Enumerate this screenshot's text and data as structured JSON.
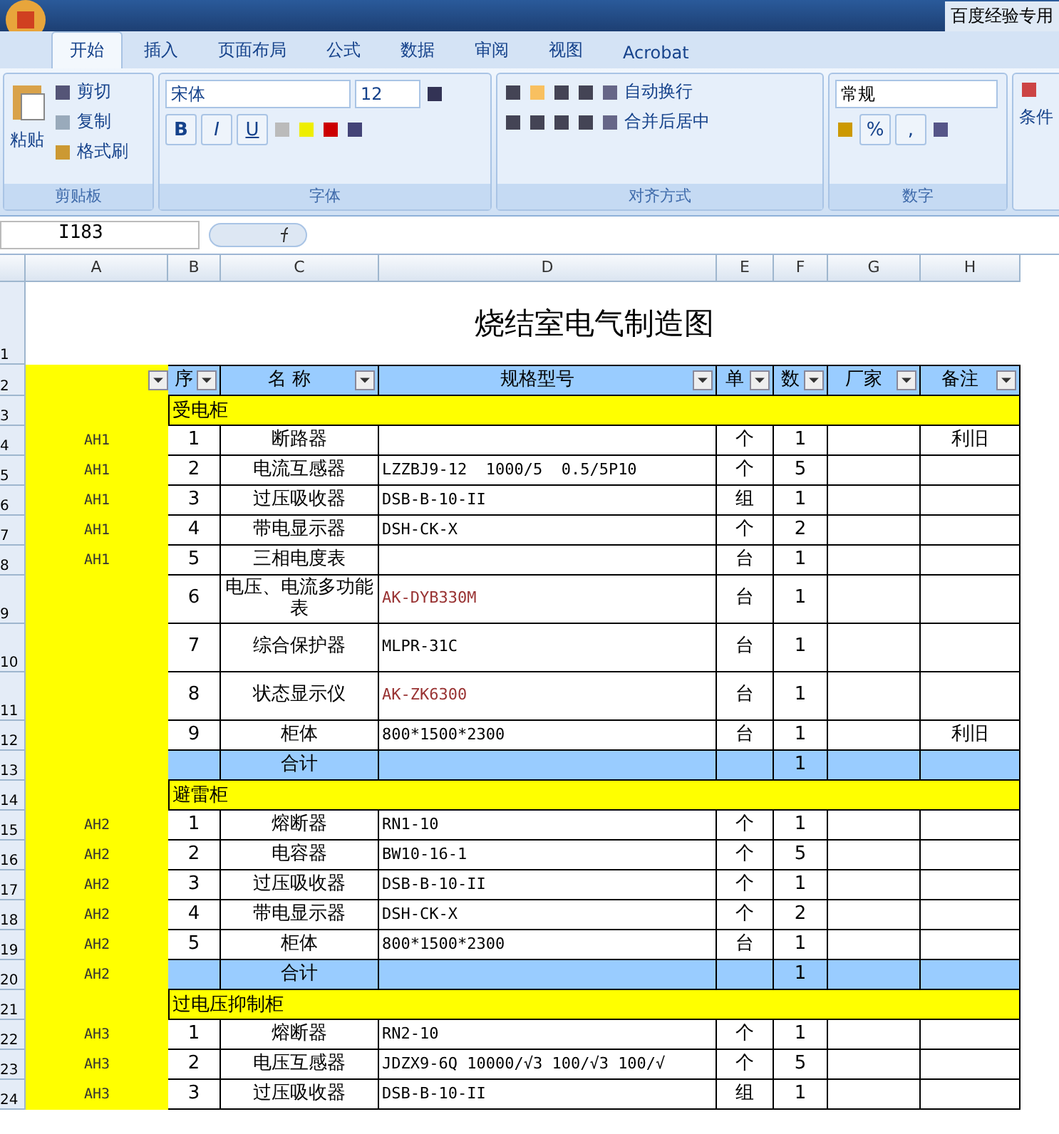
{
  "window": {
    "title": "百度经验专用"
  },
  "tabs": [
    {
      "label": "开始",
      "selected": true
    },
    {
      "label": "插入",
      "selected": false
    },
    {
      "label": "页面布局",
      "selected": false
    },
    {
      "label": "公式",
      "selected": false
    },
    {
      "label": "数据",
      "selected": false
    },
    {
      "label": "审阅",
      "selected": false
    },
    {
      "label": "视图",
      "selected": false
    },
    {
      "label": "Acrobat",
      "selected": false
    }
  ],
  "ribbon": {
    "clipboard": {
      "paste": "粘贴",
      "cut": "剪切",
      "copy": "复制",
      "format_painter": "格式刷",
      "label": "剪贴板"
    },
    "font": {
      "name": "宋体",
      "size": "12",
      "bold": "B",
      "italic": "I",
      "underline": "U",
      "label": "字体"
    },
    "alignment": {
      "wrap": "自动换行",
      "merge": "合并后居中",
      "label": "对齐方式"
    },
    "number": {
      "format": "常规",
      "percent": "%",
      "comma": ",",
      "label": "数字"
    },
    "styles": {
      "conditional": "条件"
    }
  },
  "name_box": "I183",
  "columns": [
    "A",
    "B",
    "C",
    "D",
    "E",
    "F",
    "G",
    "H"
  ],
  "sheet_title": "烧结室电气制造图",
  "row_numbers": [
    "1",
    "2",
    "3",
    "4",
    "5",
    "6",
    "7",
    "8",
    "9",
    "10",
    "11",
    "12",
    "13",
    "14",
    "15",
    "16",
    "17",
    "18",
    "19",
    "20",
    "21",
    "22",
    "23",
    "24"
  ],
  "header": [
    "序",
    "名 称",
    "规格型号",
    "单",
    "数",
    "厂家",
    "备注"
  ],
  "rows": [
    {
      "kind": "section",
      "label": "受电柜"
    },
    {
      "kind": "item",
      "cells": [
        "AH1",
        "1",
        "断路器",
        "",
        "个",
        "1",
        "",
        "利旧"
      ]
    },
    {
      "kind": "item",
      "cells": [
        "AH1",
        "2",
        "电流互感器",
        "LZZBJ9-12  1000/5  0.5/5P10",
        "个",
        "5",
        "",
        ""
      ]
    },
    {
      "kind": "item",
      "cells": [
        "AH1",
        "3",
        "过压吸收器",
        "DSB-B-10-II",
        "组",
        "1",
        "",
        ""
      ]
    },
    {
      "kind": "item",
      "cells": [
        "AH1",
        "4",
        "带电显示器",
        "DSH-CK-X",
        "个",
        "2",
        "",
        ""
      ]
    },
    {
      "kind": "item",
      "cells": [
        "AH1",
        "5",
        "三相电度表",
        "",
        "台",
        "1",
        "",
        ""
      ]
    },
    {
      "kind": "tall",
      "cells": [
        "",
        "6",
        "电压、电流多功能表",
        "AK-DYB330M",
        "台",
        "1",
        "",
        ""
      ],
      "color": "#993333"
    },
    {
      "kind": "tall",
      "cells": [
        "",
        "7",
        "综合保护器",
        "MLPR-31C",
        "台",
        "1",
        "",
        ""
      ],
      "color": "#000000"
    },
    {
      "kind": "tall",
      "cells": [
        "",
        "8",
        "状态显示仪",
        "AK-ZK6300",
        "台",
        "1",
        "",
        ""
      ],
      "color": "#993333"
    },
    {
      "kind": "item",
      "cells": [
        "",
        "9",
        "柜体",
        "800*1500*2300",
        "台",
        "1",
        "",
        "利旧"
      ]
    },
    {
      "kind": "total",
      "cells": [
        "",
        "",
        "合计",
        "",
        "",
        "1",
        "",
        ""
      ]
    },
    {
      "kind": "section",
      "label": "避雷柜"
    },
    {
      "kind": "item",
      "cells": [
        "AH2",
        "1",
        "熔断器",
        "RN1-10",
        "个",
        "1",
        "",
        ""
      ]
    },
    {
      "kind": "item",
      "cells": [
        "AH2",
        "2",
        "电容器",
        "BW10-16-1",
        "个",
        "5",
        "",
        ""
      ]
    },
    {
      "kind": "item",
      "cells": [
        "AH2",
        "3",
        "过压吸收器",
        "DSB-B-10-II",
        "个",
        "1",
        "",
        ""
      ]
    },
    {
      "kind": "item",
      "cells": [
        "AH2",
        "4",
        "带电显示器",
        "DSH-CK-X",
        "个",
        "2",
        "",
        ""
      ]
    },
    {
      "kind": "item",
      "cells": [
        "AH2",
        "5",
        "柜体",
        "800*1500*2300",
        "台",
        "1",
        "",
        ""
      ]
    },
    {
      "kind": "total",
      "cells": [
        "AH2",
        "",
        "合计",
        "",
        "",
        "1",
        "",
        ""
      ]
    },
    {
      "kind": "section",
      "label": "过电压抑制柜"
    },
    {
      "kind": "item",
      "cells": [
        "AH3",
        "1",
        "熔断器",
        "RN2-10",
        "个",
        "1",
        "",
        ""
      ]
    },
    {
      "kind": "item",
      "cells": [
        "AH3",
        "2",
        "电压互感器",
        "JDZX9-6Q 10000/√3 100/√3 100/√",
        "个",
        "5",
        "",
        ""
      ]
    },
    {
      "kind": "item",
      "cells": [
        "AH3",
        "3",
        "过压吸收器",
        "DSB-B-10-II",
        "组",
        "1",
        "",
        ""
      ]
    }
  ]
}
